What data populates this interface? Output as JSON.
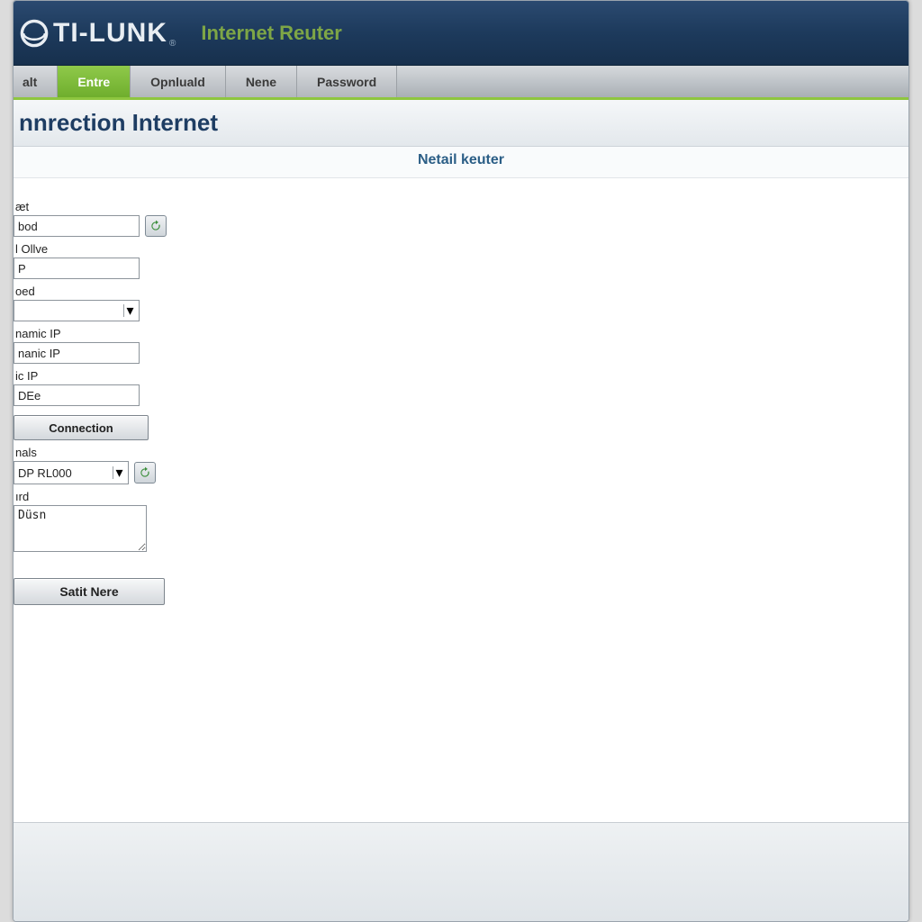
{
  "header": {
    "brand": "TI-LUNK",
    "brand_suffix": "®",
    "product": "Internet Reuter"
  },
  "nav": {
    "items": [
      {
        "label": "alt",
        "active": false
      },
      {
        "label": "Entre",
        "active": true
      },
      {
        "label": "Opnluald",
        "active": false
      },
      {
        "label": "Nene",
        "active": false
      },
      {
        "label": "Password",
        "active": false
      }
    ]
  },
  "page": {
    "title": "nnrection Internet",
    "subtitle": "Netail keuter"
  },
  "form": {
    "f1": {
      "label": "æt",
      "value": "bod"
    },
    "f2": {
      "label": "l Ollve",
      "value": "P"
    },
    "f3": {
      "label": "oed",
      "value": ""
    },
    "f4": {
      "label": "namic IP",
      "value": "nanic IP"
    },
    "f5": {
      "label": "ic IP",
      "value": "DEe"
    },
    "connection_btn": "Connection",
    "f6": {
      "label": "nals",
      "value": "DP RL000"
    },
    "f7": {
      "label": "ırd",
      "value": "Düsn"
    },
    "submit_btn": "Satit Nere"
  },
  "icons": {
    "refresh": "refresh-icon"
  }
}
